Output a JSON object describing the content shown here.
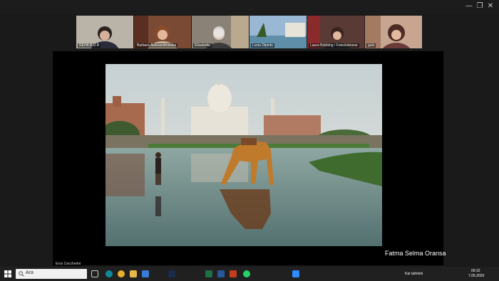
{
  "window": {
    "controls": [
      "—",
      "❐",
      "✕"
    ]
  },
  "participants": [
    {
      "name": "REHA B.U.R"
    },
    {
      "name": "Barbara Aleksandrowska"
    },
    {
      "name": "Elisabetta"
    },
    {
      "name": "Lucia Dipinto"
    },
    {
      "name": "Laura Bobbing / Fotoclubnove"
    },
    {
      "name": "gulu"
    }
  ],
  "active_speaker": "Eros Ceccherini",
  "shared_by": "Fatma Selma Oransa",
  "taskbar": {
    "search_placeholder": "Ara",
    "weather": "Kar tahmini",
    "time": "00:12",
    "date": "7.05.2020"
  },
  "colors": {
    "sky": "#cfd6d8",
    "water": "#6e8e8c",
    "grass": "#3f6b2f",
    "camel": "#c07a2c"
  }
}
